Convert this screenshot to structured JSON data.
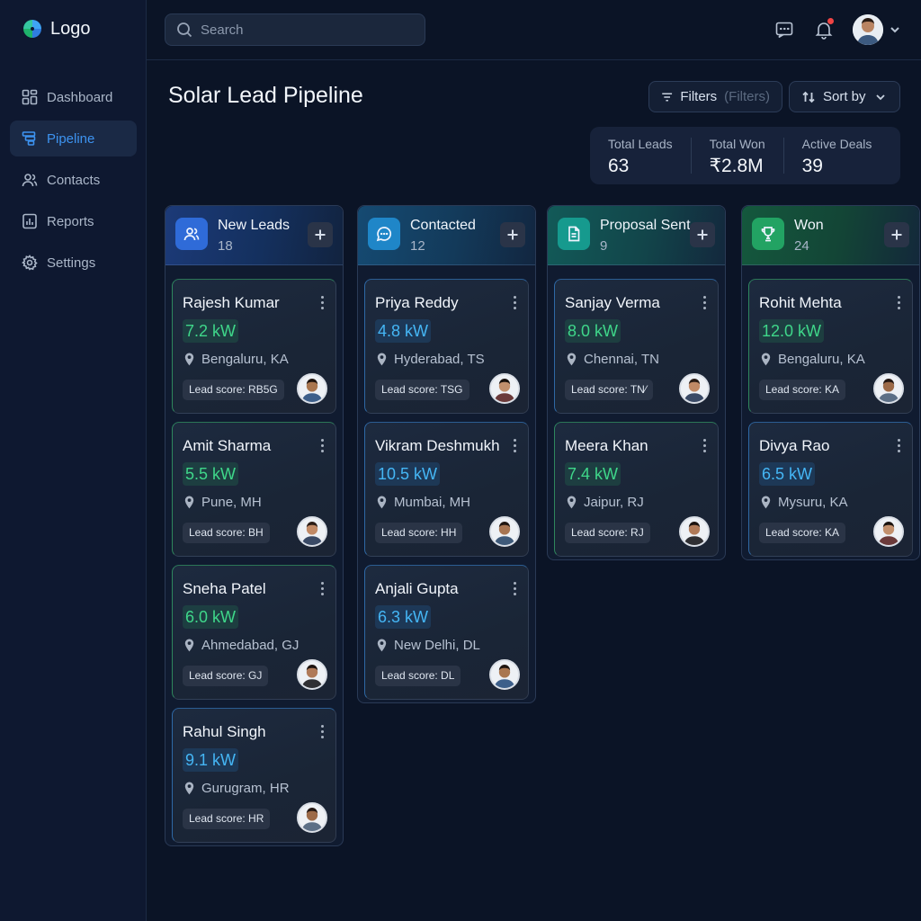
{
  "app": {
    "logo_text": "Logo"
  },
  "sidebar": {
    "items": [
      {
        "label": "Dashboard",
        "icon": "grid-icon",
        "active": false
      },
      {
        "label": "Pipeline",
        "icon": "pipeline-icon",
        "active": true
      },
      {
        "label": "Contacts",
        "icon": "users-icon",
        "active": false
      },
      {
        "label": "Reports",
        "icon": "chart-icon",
        "active": false
      },
      {
        "label": "Settings",
        "icon": "gear-icon",
        "active": false
      }
    ]
  },
  "header": {
    "search_placeholder": "Search"
  },
  "page": {
    "title": "Solar Lead Pipeline",
    "filters_label": "Filters",
    "filters_hint": "(Filters)",
    "sort_label": "Sort by"
  },
  "stats": [
    {
      "label": "Total Leads",
      "value": "63"
    },
    {
      "label": "Total Won",
      "value": "₹2.8M"
    },
    {
      "label": "Active Deals",
      "value": "39"
    }
  ],
  "columns": [
    {
      "title": "New Leads",
      "count": "18",
      "icon": "users-icon",
      "accent": "#2f6bd8",
      "cards": [
        {
          "name": "Rajesh Kumar",
          "kw": "7.2 kW",
          "kw_color": "green",
          "location": "Bengaluru, KA",
          "score": "Lead score: RB5G",
          "border": "green"
        },
        {
          "name": "Amit Sharma",
          "kw": "5.5 kW",
          "kw_color": "green",
          "location": "Pune, MH",
          "score": "Lead score: BH",
          "border": "green"
        },
        {
          "name": "Sneha Patel",
          "kw": "6.0 kW",
          "kw_color": "green",
          "location": "Ahmedabad, GJ",
          "score": "Lead score: GJ",
          "border": "green"
        },
        {
          "name": "Rahul Singh",
          "kw": "9.1 kW",
          "kw_color": "blue",
          "location": "Gurugram, HR",
          "score": "Lead score: HR",
          "border": "blue"
        }
      ]
    },
    {
      "title": "Contacted",
      "count": "12",
      "icon": "chat-icon",
      "accent": "#1f86c8",
      "cards": [
        {
          "name": "Priya Reddy",
          "kw": "4.8 kW",
          "kw_color": "blue",
          "location": "Hyderabad, TS",
          "score": "Lead score: TSG",
          "border": "blue"
        },
        {
          "name": "Vikram Deshmukh",
          "kw": "10.5 kW",
          "kw_color": "blue",
          "location": "Mumbai, MH",
          "score": "Lead score: HH",
          "border": "blue"
        },
        {
          "name": "Anjali Gupta",
          "kw": "6.3 kW",
          "kw_color": "blue",
          "location": "New Delhi, DL",
          "score": "Lead score: DL",
          "border": "blue"
        }
      ]
    },
    {
      "title": "Proposal Sent",
      "count": "9",
      "icon": "document-icon",
      "accent": "#169a8e",
      "cards": [
        {
          "name": "Sanjay Verma",
          "kw": "8.0 kW",
          "kw_color": "green",
          "location": "Chennai, TN",
          "score": "Lead score: TN⁄",
          "border": "blue"
        },
        {
          "name": "Meera Khan",
          "kw": "7.4 kW",
          "kw_color": "green",
          "location": "Jaipur, RJ",
          "score": "Lead score: RJ",
          "border": "green"
        }
      ]
    },
    {
      "title": "Won",
      "count": "24",
      "icon": "trophy-icon",
      "accent": "#22a363",
      "cards": [
        {
          "name": "Rohit Mehta",
          "kw": "12.0 kW",
          "kw_color": "green",
          "location": "Bengaluru, KA",
          "score": "Lead score: KA",
          "border": "green"
        },
        {
          "name": "Divya Rao",
          "kw": "6.5 kW",
          "kw_color": "blue",
          "location": "Mysuru, KA",
          "score": "Lead score: KA",
          "border": "blue"
        }
      ]
    }
  ]
}
